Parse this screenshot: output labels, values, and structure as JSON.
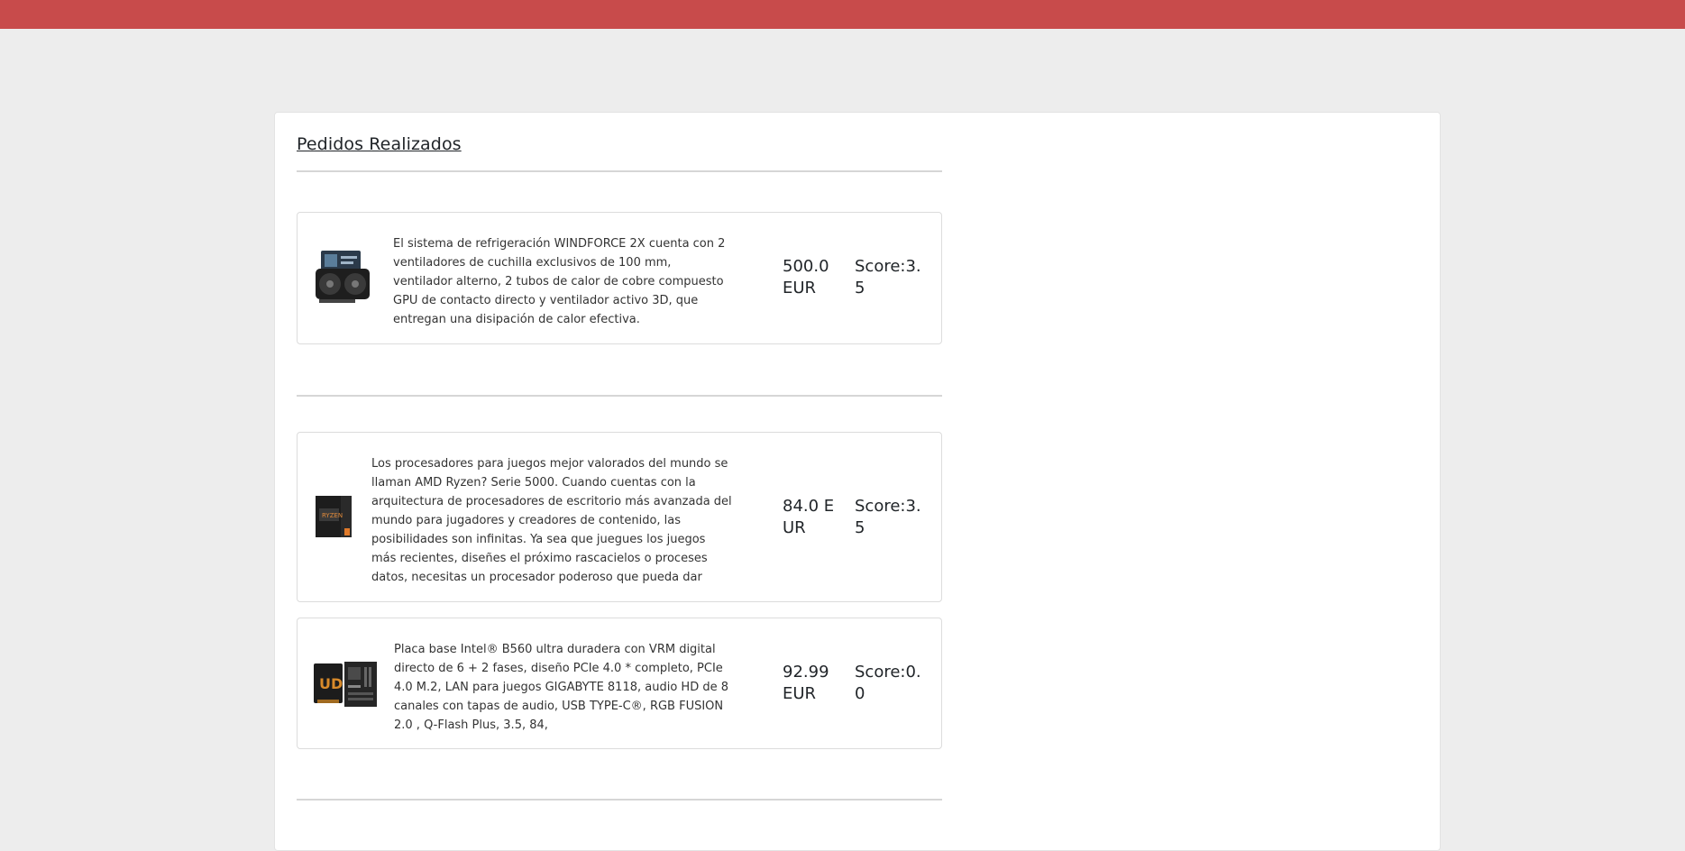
{
  "header": {
    "bar_color": "#c84b4b"
  },
  "section": {
    "title": "Pedidos Realizados"
  },
  "orders": [
    {
      "image_icon": "graphics-card-image",
      "description": "El sistema de refrigeración WINDFORCE 2X cuenta con 2 ventiladores de cuchilla exclusivos de 100 mm, ventilador alterno, 2 tubos de calor de cobre compuesto GPU de contacto directo y ventilador activo 3D, que entregan una disipación de calor efectiva.",
      "price": "500.0 EUR",
      "score": "Score:3.5"
    },
    {
      "image_icon": "processor-box-image",
      "description": "Los procesadores para juegos mejor valorados del mundo se llaman AMD Ryzen? Serie 5000. Cuando cuentas con la arquitectura de procesadores de escritorio más avanzada del mundo para jugadores y creadores de contenido, las posibilidades son infinitas. Ya sea que juegues los juegos más recientes, diseñes el próximo rascacielos o proceses datos, necesitas un procesador poderoso que pueda dar",
      "price": "84.0 EUR",
      "score": "Score:3.5"
    },
    {
      "image_icon": "motherboard-image",
      "description": "Placa base Intel® B560 ultra duradera con VRM digital directo de 6 + 2 fases, diseño PCIe 4.0 * completo, PCIe 4.0 M.2, LAN para juegos GIGABYTE 8118, audio HD de 8 canales con tapas de audio, USB TYPE-C®, RGB FUSION 2.0 , Q-Flash Plus, 3.5, 84,",
      "price": "92.99 EUR",
      "score": "Score:0.0"
    }
  ]
}
